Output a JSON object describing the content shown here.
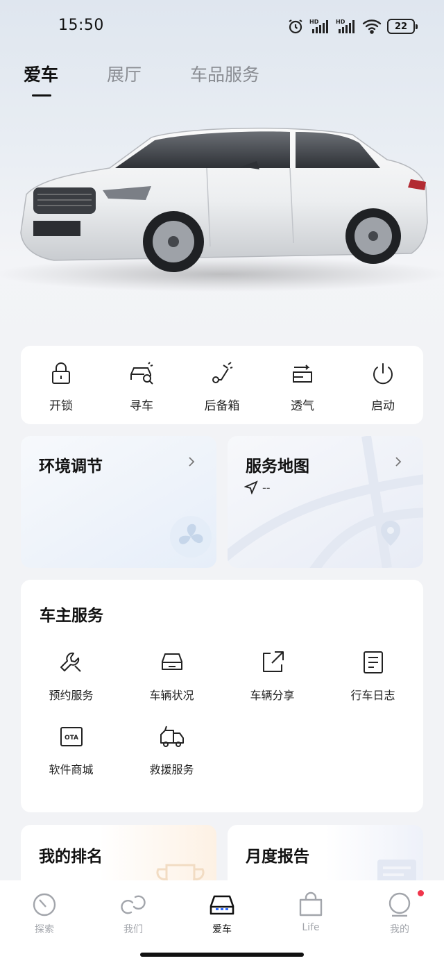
{
  "status_bar": {
    "time": "15:50",
    "battery": "22",
    "icons": [
      "alarm-icon",
      "hd-signal-icon",
      "hd-signal-icon",
      "wifi-icon",
      "battery-icon"
    ],
    "hd_label": "HD"
  },
  "top_tabs": [
    {
      "label": "爱车",
      "active": true
    },
    {
      "label": "展厅",
      "active": false
    },
    {
      "label": "车品服务",
      "active": false
    }
  ],
  "quick_controls": [
    {
      "label": "开锁",
      "icon": "lock-icon"
    },
    {
      "label": "寻车",
      "icon": "find-car-icon"
    },
    {
      "label": "后备箱",
      "icon": "trunk-icon"
    },
    {
      "label": "透气",
      "icon": "ventilate-icon"
    },
    {
      "label": "启动",
      "icon": "power-icon"
    }
  ],
  "env_tile": {
    "title": "环境调节"
  },
  "map_tile": {
    "title": "服务地图",
    "location": "--"
  },
  "owner_services": {
    "title": "车主服务",
    "items": [
      {
        "label": "预约服务",
        "icon": "wrench-icon"
      },
      {
        "label": "车辆状况",
        "icon": "car-status-icon"
      },
      {
        "label": "车辆分享",
        "icon": "share-icon"
      },
      {
        "label": "行车日志",
        "icon": "log-icon"
      },
      {
        "label": "软件商城",
        "icon": "ota-icon",
        "badge": "OTA"
      },
      {
        "label": "救援服务",
        "icon": "tow-truck-icon"
      }
    ]
  },
  "rank_tile": {
    "title": "我的排名"
  },
  "report_tile": {
    "title": "月度报告"
  },
  "bottom_nav": [
    {
      "label": "探索",
      "icon": "compass-icon",
      "active": false
    },
    {
      "label": "我们",
      "icon": "community-icon",
      "active": false
    },
    {
      "label": "爱车",
      "icon": "car-icon",
      "active": true
    },
    {
      "label": "Life",
      "icon": "shopping-bag-icon",
      "active": false
    },
    {
      "label": "我的",
      "icon": "profile-icon",
      "active": false,
      "badge": true
    }
  ],
  "colors": {
    "accent": "#111111",
    "inactive": "#a2a5ab",
    "badge": "#f0354b",
    "car_nav_accent": "#2f6bff"
  }
}
